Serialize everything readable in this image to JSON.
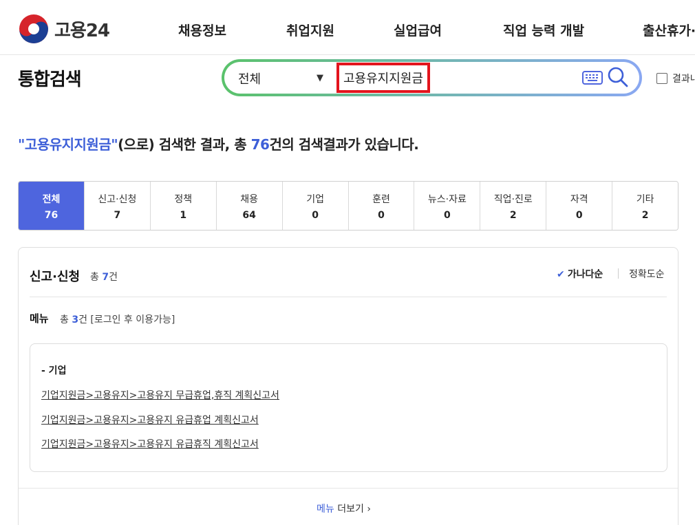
{
  "header": {
    "logo_text": "고용24",
    "nav": [
      "채용정보",
      "취업지원",
      "실업급여",
      "직업 능력 개발",
      "출산휴가·"
    ]
  },
  "search": {
    "page_title": "통합검색",
    "scope": "전체",
    "query": "고용유지지원금",
    "result_filter_label": "결과내"
  },
  "summary": {
    "quote_open": "\"",
    "keyword": "고용유지지원금",
    "quote_close": "\"",
    "text_mid": "(으로) 검색한 결과, 총 ",
    "total": "76",
    "text_end": "건의 검색결과가 있습니다."
  },
  "tabs": [
    {
      "label": "전체",
      "count": "76",
      "active": true
    },
    {
      "label": "신고·신청",
      "count": "7"
    },
    {
      "label": "정책",
      "count": "1"
    },
    {
      "label": "채용",
      "count": "64"
    },
    {
      "label": "기업",
      "count": "0"
    },
    {
      "label": "훈련",
      "count": "0"
    },
    {
      "label": "뉴스·자료",
      "count": "0"
    },
    {
      "label": "직업·진로",
      "count": "2"
    },
    {
      "label": "자격",
      "count": "0"
    },
    {
      "label": "기타",
      "count": "2"
    }
  ],
  "section": {
    "title": "신고·신청",
    "total_prefix": "총 ",
    "total_count": "7",
    "total_suffix": "건",
    "sort_options": [
      "가나다순",
      "정확도순"
    ],
    "sort_active": "가나다순",
    "menu": {
      "label": "메뉴",
      "total_prefix": "총 ",
      "total_count": "3",
      "total_suffix": "건 [로그인 후 이용가능]",
      "group_title": "- 기업",
      "links": [
        "기업지원금>고용유지>고용유지 무급휴업,휴직 계획신고서",
        "기업지원금>고용유지>고용유지 유급휴업 계획신고서",
        "기업지원금>고용유지>고용유지 유급휴직 계획신고서"
      ],
      "more_keyword": "메뉴",
      "more_text": " 더보기",
      "more_arrow": "›"
    }
  },
  "colors": {
    "accent": "#3d5fd8",
    "active_tab": "#4e65de",
    "highlight_border": "#e3141d",
    "logo_blue": "#1c3f94",
    "logo_red": "#d6242b"
  },
  "icons": {
    "keyboard": "keyboard-icon",
    "search": "search-icon",
    "check": "checkmark-icon",
    "logo": "taegeuk-logo"
  }
}
